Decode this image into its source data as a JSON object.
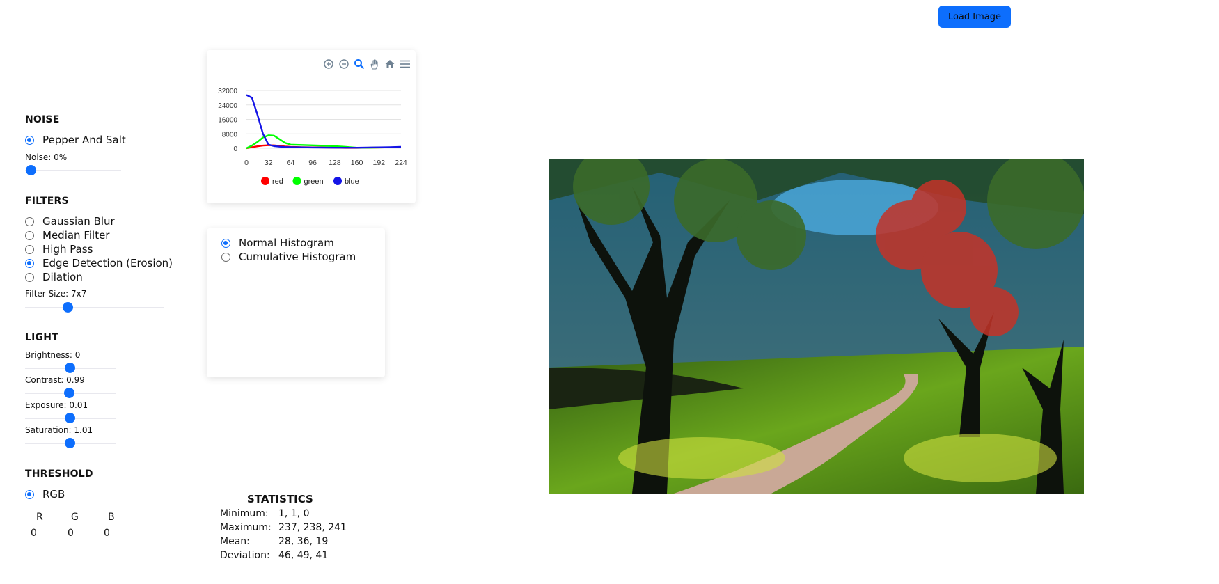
{
  "header": {
    "load_button_label": "Load Image"
  },
  "sidebar": {
    "noise": {
      "title": "NOISE",
      "options": [
        {
          "label": "Pepper And Salt",
          "checked": true
        }
      ],
      "slider_label": "Noise: 0%",
      "slider_value": 0
    },
    "filters": {
      "title": "FILTERS",
      "options": [
        {
          "label": "Gaussian Blur",
          "checked": false
        },
        {
          "label": "Median Filter",
          "checked": false
        },
        {
          "label": "High Pass",
          "checked": false
        },
        {
          "label": "Edge Detection (Erosion)",
          "checked": true
        },
        {
          "label": "Dilation",
          "checked": false
        }
      ],
      "slider_label": "Filter Size: 7x7"
    },
    "light": {
      "title": "LIGHT",
      "sliders": [
        {
          "label": "Brightness: 0"
        },
        {
          "label": "Contrast: 0.99"
        },
        {
          "label": "Exposure: 0.01"
        },
        {
          "label": "Saturation: 1.01"
        }
      ]
    },
    "threshold": {
      "title": "THRESHOLD",
      "options": [
        {
          "label": "RGB",
          "checked": true
        }
      ],
      "channels": [
        {
          "name": "R",
          "value": "0"
        },
        {
          "name": "G",
          "value": "0"
        },
        {
          "name": "B",
          "value": "0"
        }
      ]
    }
  },
  "chart_toolbar": [
    "zoom-in-icon",
    "zoom-out-icon",
    "magnifier-icon",
    "pan-hand-icon",
    "home-icon",
    "menu-icon"
  ],
  "chart_data": {
    "type": "line",
    "title": "",
    "xlabel": "",
    "ylabel": "",
    "x_ticks": [
      "0",
      "32",
      "64",
      "96",
      "128",
      "160",
      "192",
      "224"
    ],
    "y_ticks": [
      "32000",
      "24000",
      "16000",
      "8000",
      "0"
    ],
    "xlim": [
      0,
      224
    ],
    "ylim": [
      0,
      32000
    ],
    "x": [
      0,
      8,
      16,
      24,
      32,
      40,
      48,
      56,
      64,
      80,
      96,
      112,
      128,
      144,
      160,
      176,
      192,
      208,
      224
    ],
    "series": [
      {
        "name": "red",
        "color": "#ff0000",
        "values": [
          0,
          600,
          1100,
          1500,
          1700,
          1600,
          1300,
          1000,
          800,
          600,
          500,
          400,
          300,
          200,
          200,
          300,
          400,
          500,
          600
        ]
      },
      {
        "name": "green",
        "color": "#00ff00",
        "values": [
          0,
          1500,
          3500,
          6000,
          7200,
          7000,
          5000,
          3000,
          2000,
          1800,
          1600,
          1400,
          1200,
          800,
          300,
          300,
          400,
          500,
          500
        ]
      },
      {
        "name": "blue",
        "color": "#1414e6",
        "values": [
          29500,
          28000,
          18500,
          8000,
          2000,
          1200,
          900,
          700,
          600,
          500,
          400,
          350,
          300,
          300,
          300,
          400,
          500,
          600,
          800
        ]
      }
    ],
    "legend": "bottom-center",
    "grid": true
  },
  "histogram_options": [
    {
      "label": "Normal Histogram",
      "checked": true
    },
    {
      "label": "Cumulative Histogram",
      "checked": false
    }
  ],
  "statistics": {
    "title": "STATISTICS",
    "rows": [
      {
        "label": "Minimum:",
        "value": "1, 1, 0"
      },
      {
        "label": "Maximum:",
        "value": "237, 238, 241"
      },
      {
        "label": "Mean:",
        "value": "28, 36, 19"
      },
      {
        "label": "Deviation:",
        "value": "46, 49, 41"
      }
    ]
  }
}
